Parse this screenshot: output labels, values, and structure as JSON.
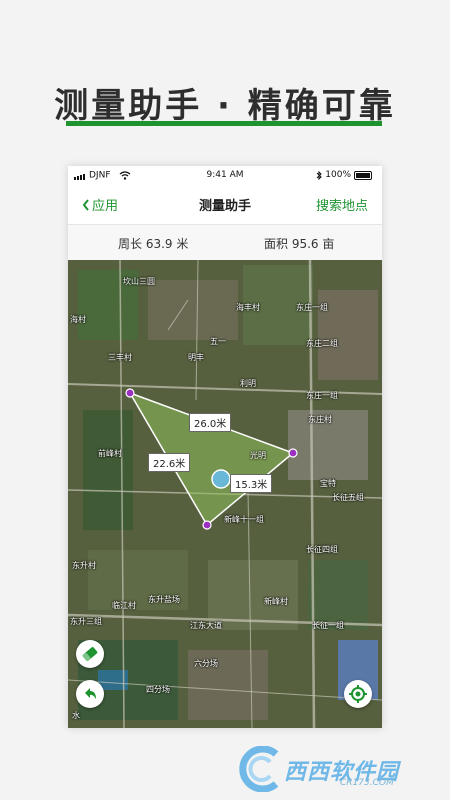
{
  "headline": {
    "title": "测量助手 · 精确可靠"
  },
  "status_bar": {
    "carrier": "DJNF",
    "time": "9:41 AM",
    "battery": "100%"
  },
  "nav": {
    "back_label": "应用",
    "title": "测量助手",
    "action_label": "搜索地点"
  },
  "stats": {
    "perimeter": "周长 63.9 米",
    "area": "面积 95.6 亩"
  },
  "map": {
    "place_labels": [
      "坎山三圆",
      "海丰村",
      "东庄一组",
      "海村",
      "五一",
      "东庄二组",
      "三丰村",
      "明丰",
      "利明",
      "东庄一组",
      "东庄村",
      "前峰村",
      "光明",
      "宝特",
      "长征五组",
      "新峰十一组",
      "长征四组",
      "东升村",
      "东升盐场",
      "新峰村",
      "临江村",
      "东升三组",
      "江东大道",
      "长征一组",
      "六分场",
      "四分场",
      "水"
    ],
    "distance_labels": [
      "26.0米",
      "22.6米",
      "15.3米"
    ],
    "colors": {
      "polygon_fill": "#8fbf5a",
      "polygon_stroke": "#ffffff",
      "vertex": "#9b2fc2",
      "accent": "#1e9430"
    }
  },
  "controls": {
    "eraser_icon": "eraser-icon",
    "undo_icon": "undo-icon",
    "locate_icon": "locate-icon"
  },
  "watermark": {
    "text": "西西软件园",
    "url": "CR173.COM"
  }
}
